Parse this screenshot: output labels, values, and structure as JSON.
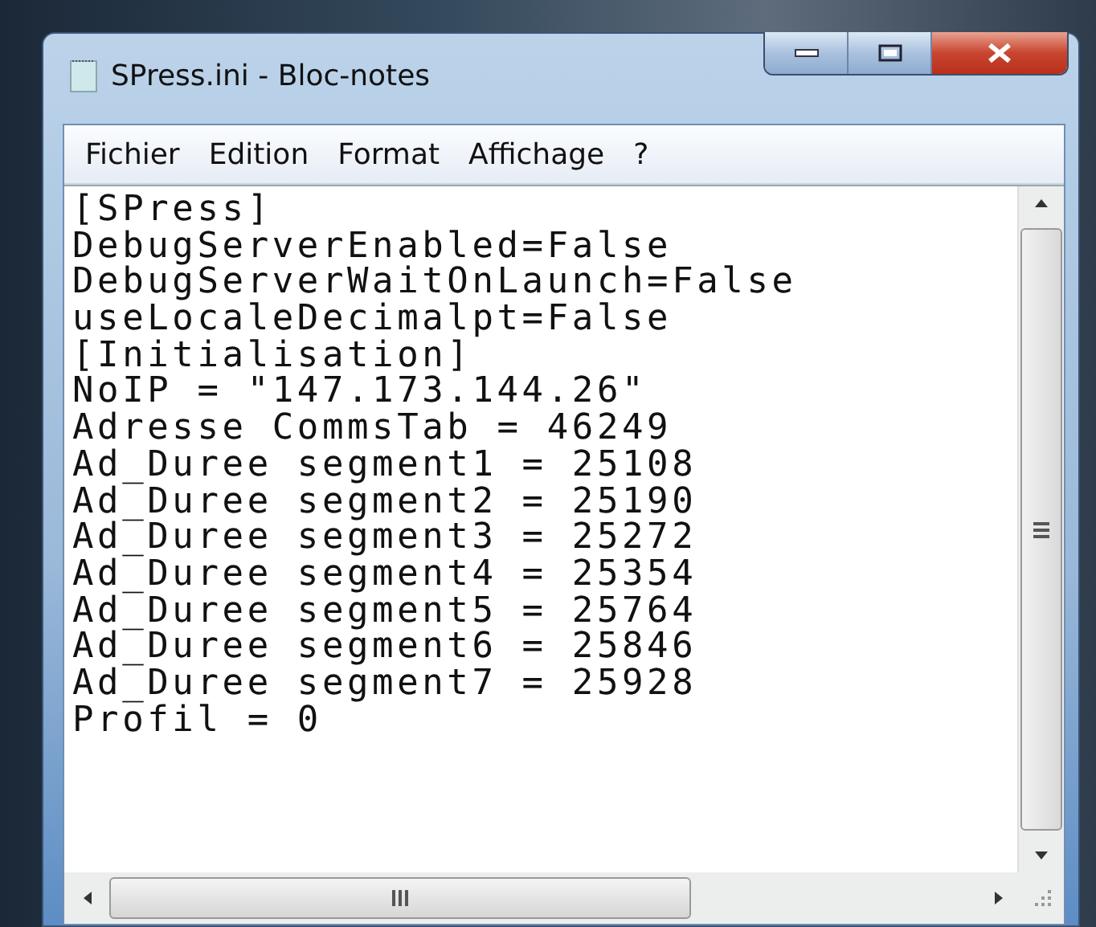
{
  "window": {
    "title": "SPress.ini - Bloc-notes"
  },
  "menu": [
    "Fichier",
    "Edition",
    "Format",
    "Affichage",
    "?"
  ],
  "editor": {
    "lines": [
      "[SPress]",
      "DebugServerEnabled=False",
      "DebugServerWaitOnLaunch=False",
      "useLocaleDecimalpt=False",
      "[Initialisation]",
      "NoIP = \"147.173.144.26\"",
      "Adresse CommsTab = 46249",
      "Ad_Duree segment1 = 25108",
      "Ad_Duree segment2 = 25190",
      "Ad_Duree segment3 = 25272",
      "Ad_Duree segment4 = 25354",
      "Ad_Duree segment5 = 25764",
      "Ad_Duree segment6 = 25846",
      "Ad_Duree segment7 = 25928",
      "Profil = 0"
    ]
  }
}
